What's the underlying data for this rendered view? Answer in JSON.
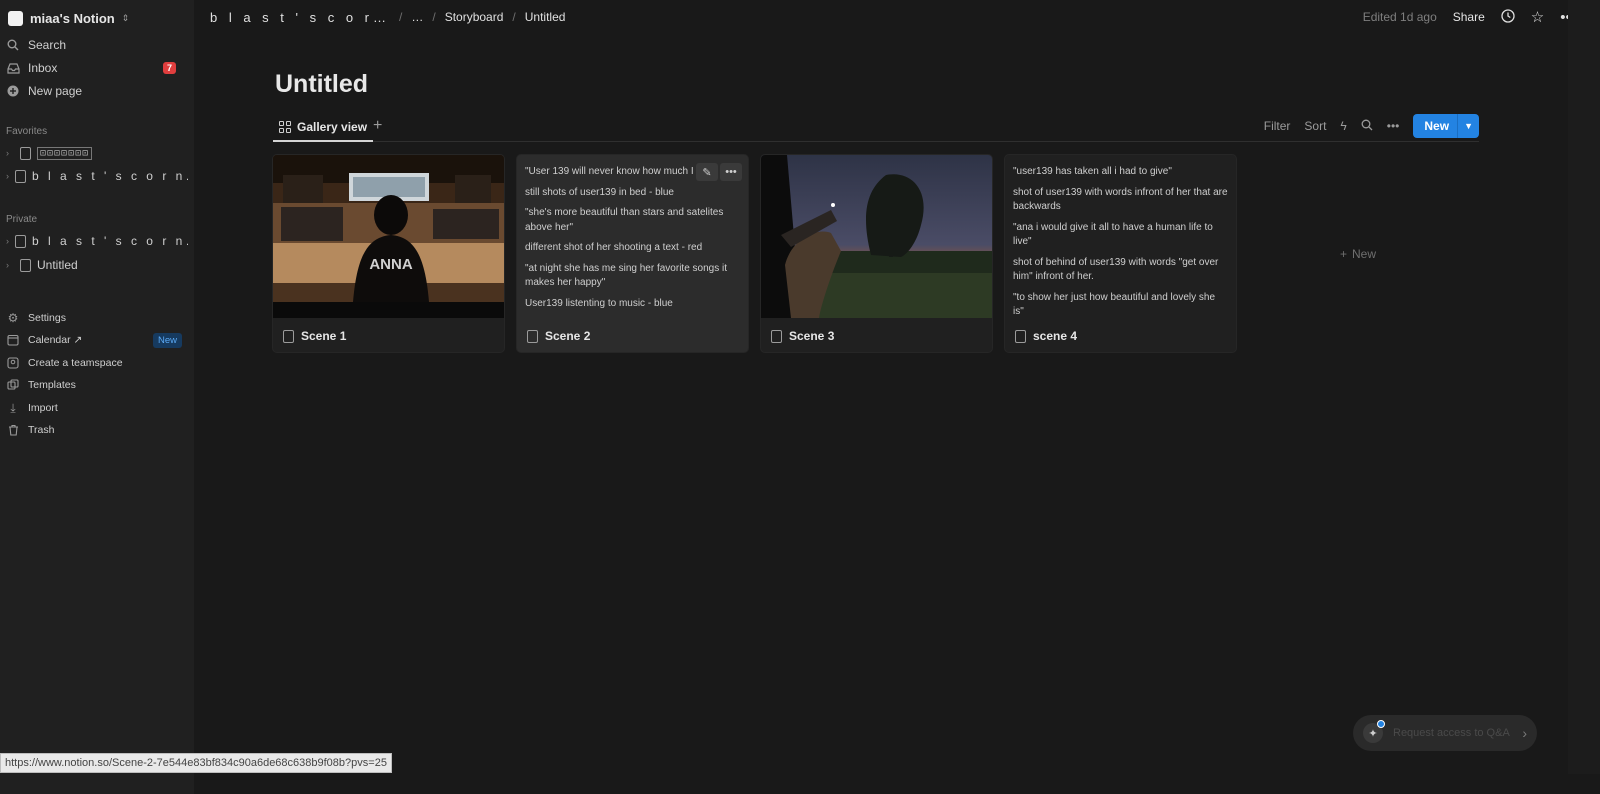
{
  "workspace": {
    "name": "miaa's Notion"
  },
  "sidebar": {
    "search": "Search",
    "inbox": "Inbox",
    "inbox_count": "7",
    "new_page": "New page",
    "favorites_label": "Favorites",
    "favorites": [
      "⊡⊡⊡⊡⊡⊡⊡",
      "b l a s t ' s c o r n…"
    ],
    "private_label": "Private",
    "private": [
      "b l a s t ' s c o r n…",
      "Untitled"
    ],
    "settings": "Settings",
    "calendar": "Calendar ↗",
    "calendar_badge": "New",
    "create_teamspace": "Create a teamspace",
    "templates": "Templates",
    "import": "Import",
    "trash": "Trash"
  },
  "breadcrumb": [
    "b l a s t ' s c o r…",
    "…",
    "Storyboard",
    "Untitled"
  ],
  "topbar": {
    "edited": "Edited 1d ago",
    "share": "Share"
  },
  "page": {
    "title": "Untitled"
  },
  "view": {
    "tab_label": "Gallery view",
    "filter": "Filter",
    "sort": "Sort",
    "new_label": "New"
  },
  "cards": [
    {
      "name": "Scene 1"
    },
    {
      "name": "Scene 2",
      "lines": [
        "\"User 139 will never know how much I",
        "still shots of user139 in bed - blue",
        "\"she's more beautiful than stars and satelites above her\"",
        "different shot of her shooting a text - red",
        "\"at night she has me sing her favorite songs it makes her happy\"",
        "User139 listenting to music - blue"
      ]
    },
    {
      "name": "Scene 3"
    },
    {
      "name": "scene 4",
      "lines": [
        "\"user139 has taken all i had to give\"",
        "shot of user139 with words infront of her that are backwards",
        "\"ana i would give it all to have a human life to live\"",
        "shot of behind of user139 with words \"get over him\" infront of her.",
        "\"to show her just how beautiful and lovely she is\""
      ]
    }
  ],
  "add_card_label": "New",
  "status_url": "https://www.notion.so/Scene-2-7e544e83bf834c90a6de68c638b9f08b?pvs=25",
  "qa": {
    "label": "Request access to Q&A"
  },
  "colors": {
    "accent": "#2383e2",
    "badge_red": "#e03e3e",
    "background": "#191919",
    "sidebar": "#202020"
  }
}
